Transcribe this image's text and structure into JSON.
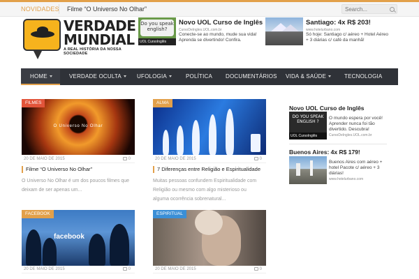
{
  "topbar": {
    "label": "NOVIDADES",
    "ticker": "Filme “O Universo No Olhar”",
    "search_placeholder": "Search..."
  },
  "logo": {
    "line1": "VERDADE",
    "line2": "MUNDIAL",
    "tagline": "A REAL HISTÓRIA DA NOSSA SOCIEDADE"
  },
  "header_ads": [
    {
      "image_top": "Do you speak english?",
      "image_strip": "UOL CursoInglês",
      "title": "Novo UOL Curso de Inglês",
      "url": "CursoDeIngles.UOL.com.br",
      "text1": "Conecte-se ao mundo, mude sua vida!",
      "text2": "Aprenda se divertindo! Confira."
    },
    {
      "title": "Santiago: 4x R$ 203!",
      "url": "www.hotelurbano.com",
      "text1": "Só hoje: Santiago c/ aéreo + Hotel Aéreo",
      "text2": "+ 3 diárias c/ café da manhã!"
    }
  ],
  "nav": {
    "items": [
      {
        "label": "HOME",
        "has_caret": true
      },
      {
        "label": "VERDADE OCULTA",
        "has_caret": true
      },
      {
        "label": "UFOLOGIA",
        "has_caret": true
      },
      {
        "label": "POLÍTICA",
        "has_caret": false
      },
      {
        "label": "DOCUMENTÁRIOS",
        "has_caret": false
      },
      {
        "label": "VIDA & SAÚDE",
        "has_caret": true
      },
      {
        "label": "TECNOLOGIA",
        "has_caret": false
      }
    ],
    "accent": "#e2a04a",
    "background": "#2f3238"
  },
  "posts": [
    {
      "tag": "FILMES",
      "tag_color": "#e2543a",
      "image_caption": "O Universo No Olhar",
      "date": "20 DE MAIO DE 2015",
      "comments": "0",
      "title": "Filme “O Universo No Olhar”",
      "excerpt1": "O Universo No Olhar é um dos poucos filmes que",
      "excerpt2": "deixam de ser apenas um..."
    },
    {
      "tag": "ALMA",
      "tag_color": "#e2a04a",
      "date": "20 DE MAIO DE 2015",
      "comments": "0",
      "title": "7 Diferenças entre Religião e Espiritualidade",
      "excerpt1": "Muitas pessoas confundem Espiritualidade com",
      "excerpt2": "Religião ou mesmo com algo misterioso ou",
      "excerpt3": "alguma ocorrência sobrenatural..."
    },
    {
      "tag": "FACEBOOK",
      "tag_color": "#e2a04a",
      "image_caption": "facebook",
      "date": "20 DE MAIO DE 2015",
      "comments": "0"
    },
    {
      "tag": "ESPIRITUAL",
      "tag_color": "#3b8fd6",
      "date": "20 DE MAIO DE 2015",
      "comments": "0"
    }
  ],
  "sidebar_ads": [
    {
      "title": "Novo UOL Curso de Inglês",
      "image_top": "DO YOU SPEAK ENGLISH ?",
      "image_strip": "UOL CursoInglês",
      "text1": "O mundo espera por você!",
      "text2": "Aprender nunca foi tão",
      "text3": "divertido. Descubra!",
      "url": "CursoDeIngles.UOL.com.br"
    },
    {
      "title": "Buenos Aires: 4x R$ 179!",
      "text1": "Buenos Aires com aéreo +",
      "text2": "hotel Pacote c/ aéreo + 3",
      "text3": "diárias!",
      "url": "www.hotelurbano.com"
    }
  ]
}
